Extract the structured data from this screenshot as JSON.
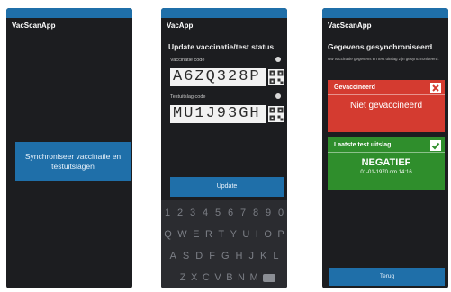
{
  "screen1": {
    "title": "VacScanApp",
    "sync_button": "Synchroniseer vaccinatie en testuitslagen"
  },
  "screen2": {
    "title": "VacApp",
    "heading": "Update vaccinatie/test status",
    "field1_label": "Vaccinatie code",
    "field1_value": "A6ZQ328P",
    "field2_label": "Testuitslag code",
    "field2_value": "MU1J93GH",
    "update_button": "Update",
    "keyboard": {
      "row1": [
        "1",
        "2",
        "3",
        "4",
        "5",
        "6",
        "7",
        "8",
        "9",
        "0"
      ],
      "row2": [
        "Q",
        "W",
        "E",
        "R",
        "T",
        "Y",
        "U",
        "I",
        "O",
        "P"
      ],
      "row3": [
        "A",
        "S",
        "D",
        "F",
        "G",
        "H",
        "J",
        "K",
        "L"
      ],
      "row4": [
        "Z",
        "X",
        "C",
        "V",
        "B",
        "N",
        "M"
      ]
    }
  },
  "screen3": {
    "title": "VacScanApp",
    "heading": "Gegevens gesynchroniseerd",
    "description": "Uw vaccinatie gegevens en test uitslag zijn gesynchroniseerd.",
    "vaccination_card": {
      "label": "Gevaccineerd",
      "status": "Niet gevaccineerd",
      "color": "#d43b30"
    },
    "test_card": {
      "label": "Laatste test uitslag",
      "result": "NEGATIEF",
      "date": "01-01-1970 om 14:16",
      "color": "#2f8e2c"
    },
    "back_button": "Terug"
  },
  "colors": {
    "accent": "#1f6fa9",
    "background": "#1c1d20"
  }
}
